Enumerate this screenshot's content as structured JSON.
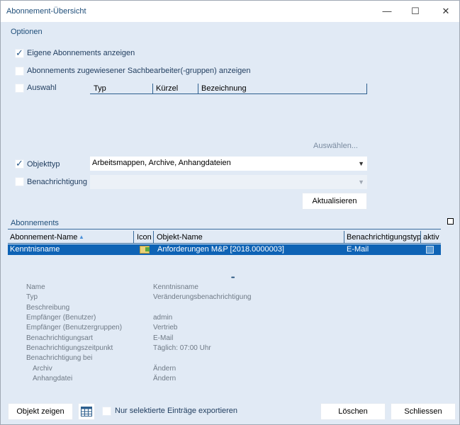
{
  "window": {
    "title": "Abonnement-Übersicht",
    "minimize": "—",
    "maximize": "☐",
    "close": "✕"
  },
  "options": {
    "title": "Optionen",
    "own_subscriptions": "Eigene Abonnements anzeigen",
    "assigned_subscriptions": "Abonnements zugewiesener Sachbearbeiter(-gruppen) anzeigen",
    "selection": "Auswahl",
    "selection_columns": [
      "Typ",
      "Kürzel",
      "Bezeichnung"
    ],
    "choose_link": "Auswählen...",
    "object_type_label": "Objekttyp",
    "object_type_value": "Arbeitsmappen, Archive, Anhangdateien",
    "notification_label": "Benachrichtigung",
    "notification_value": "",
    "refresh_button": "Aktualisieren"
  },
  "subscriptions": {
    "title": "Abonnements",
    "columns": [
      "Abonnement-Name",
      "Icon",
      "Objekt-Name",
      "Benachrichtigungstyp",
      "aktiv"
    ],
    "rows": [
      {
        "name": "Kenntnisname",
        "object": "Anforderungen M&P [2018.0000003]",
        "type": "E-Mail",
        "active": true
      }
    ],
    "ellipsis": "•••"
  },
  "details": [
    {
      "key": "Name",
      "value": "Kenntnisname"
    },
    {
      "key": "Typ",
      "value": "Veränderungsbenachrichtigung"
    },
    {
      "key": "Beschreibung",
      "value": ""
    },
    {
      "key": "Empfänger (Benutzer)",
      "value": "admin"
    },
    {
      "key": "Empfänger (Benutzergruppen)",
      "value": "Vertrieb"
    },
    {
      "key": "Benachrichtigungsart",
      "value": "E-Mail"
    },
    {
      "key": "Benachrichtigungszeitpunkt",
      "value": "Täglich: 07:00 Uhr"
    },
    {
      "key": "Benachrichtigung bei",
      "value": ""
    },
    {
      "key": "Archiv",
      "value": "Ändern"
    },
    {
      "key": "Anhangdatei",
      "value": "Ändern"
    }
  ],
  "footer": {
    "show_object": "Objekt zeigen",
    "export_selected": "Nur selektierte Einträge exportieren",
    "delete": "Löschen",
    "close": "Schliessen"
  }
}
